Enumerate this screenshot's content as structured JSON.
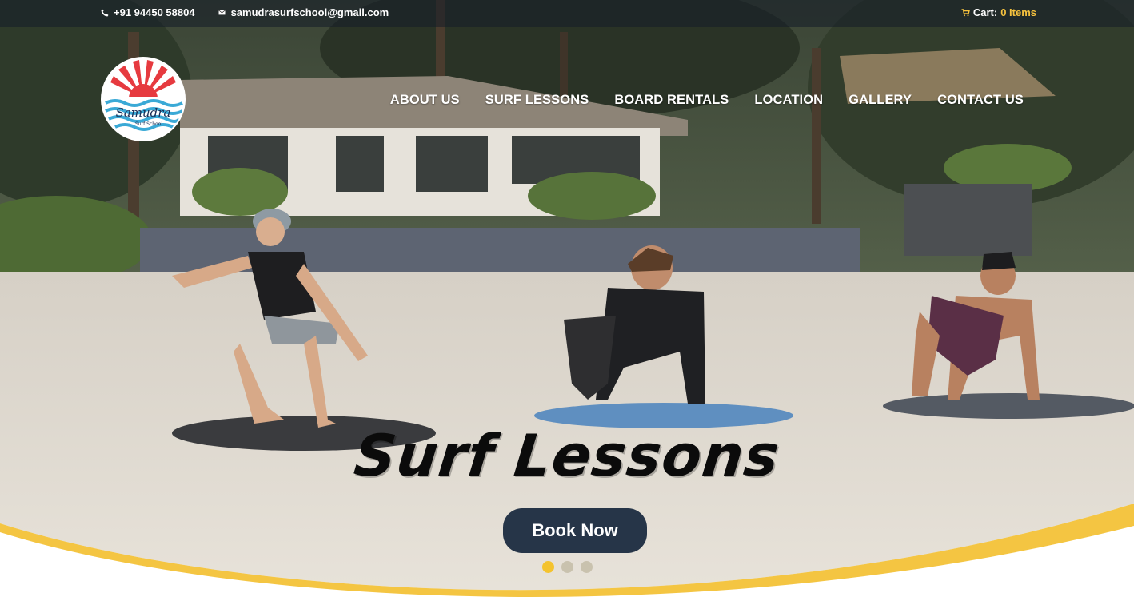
{
  "topbar": {
    "phone": "+91 94450 58804",
    "email": "samudrasurfschool@gmail.com",
    "cart_label": "Cart:",
    "cart_count": "0 Items"
  },
  "logo": {
    "brand_text": "Samudra",
    "brand_subtext": "Surf School"
  },
  "nav": {
    "items": [
      {
        "label": "ABOUT US"
      },
      {
        "label": "SURF LESSONS"
      },
      {
        "label": "BOARD RENTALS"
      },
      {
        "label": "LOCATION"
      },
      {
        "label": "GALLERY"
      },
      {
        "label": "CONTACT US"
      }
    ]
  },
  "slide": {
    "title": "Surf Lessons",
    "button_label": "Book Now",
    "active_index": 0,
    "count": 3
  },
  "colors": {
    "accent": "#f6c23e",
    "button_bg": "#263548",
    "wave": "#f4c542"
  },
  "icons": {
    "phone": "phone-icon",
    "email": "envelope-icon",
    "cart": "shopping-cart-icon"
  }
}
